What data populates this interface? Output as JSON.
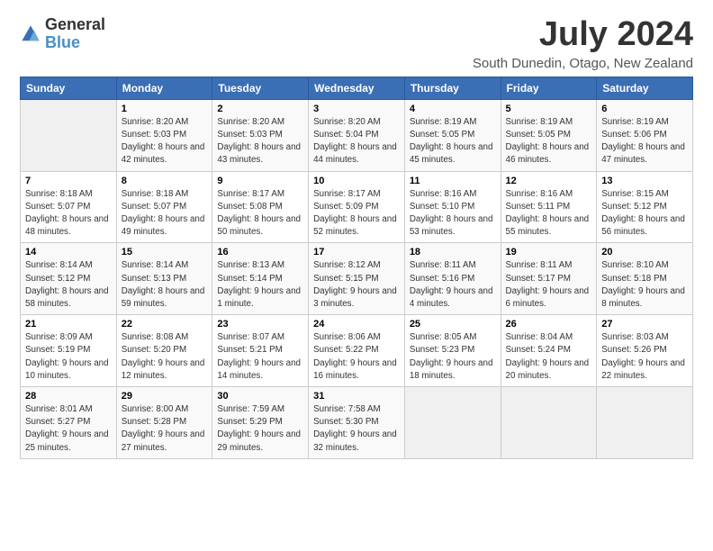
{
  "header": {
    "logo_general": "General",
    "logo_blue": "Blue",
    "title": "July 2024",
    "subtitle": "South Dunedin, Otago, New Zealand"
  },
  "days_of_week": [
    "Sunday",
    "Monday",
    "Tuesday",
    "Wednesday",
    "Thursday",
    "Friday",
    "Saturday"
  ],
  "weeks": [
    [
      {
        "day": "",
        "sunrise": "",
        "sunset": "",
        "daylight": ""
      },
      {
        "day": "1",
        "sunrise": "Sunrise: 8:20 AM",
        "sunset": "Sunset: 5:03 PM",
        "daylight": "Daylight: 8 hours and 42 minutes."
      },
      {
        "day": "2",
        "sunrise": "Sunrise: 8:20 AM",
        "sunset": "Sunset: 5:03 PM",
        "daylight": "Daylight: 8 hours and 43 minutes."
      },
      {
        "day": "3",
        "sunrise": "Sunrise: 8:20 AM",
        "sunset": "Sunset: 5:04 PM",
        "daylight": "Daylight: 8 hours and 44 minutes."
      },
      {
        "day": "4",
        "sunrise": "Sunrise: 8:19 AM",
        "sunset": "Sunset: 5:05 PM",
        "daylight": "Daylight: 8 hours and 45 minutes."
      },
      {
        "day": "5",
        "sunrise": "Sunrise: 8:19 AM",
        "sunset": "Sunset: 5:05 PM",
        "daylight": "Daylight: 8 hours and 46 minutes."
      },
      {
        "day": "6",
        "sunrise": "Sunrise: 8:19 AM",
        "sunset": "Sunset: 5:06 PM",
        "daylight": "Daylight: 8 hours and 47 minutes."
      }
    ],
    [
      {
        "day": "7",
        "sunrise": "Sunrise: 8:18 AM",
        "sunset": "Sunset: 5:07 PM",
        "daylight": "Daylight: 8 hours and 48 minutes."
      },
      {
        "day": "8",
        "sunrise": "Sunrise: 8:18 AM",
        "sunset": "Sunset: 5:07 PM",
        "daylight": "Daylight: 8 hours and 49 minutes."
      },
      {
        "day": "9",
        "sunrise": "Sunrise: 8:17 AM",
        "sunset": "Sunset: 5:08 PM",
        "daylight": "Daylight: 8 hours and 50 minutes."
      },
      {
        "day": "10",
        "sunrise": "Sunrise: 8:17 AM",
        "sunset": "Sunset: 5:09 PM",
        "daylight": "Daylight: 8 hours and 52 minutes."
      },
      {
        "day": "11",
        "sunrise": "Sunrise: 8:16 AM",
        "sunset": "Sunset: 5:10 PM",
        "daylight": "Daylight: 8 hours and 53 minutes."
      },
      {
        "day": "12",
        "sunrise": "Sunrise: 8:16 AM",
        "sunset": "Sunset: 5:11 PM",
        "daylight": "Daylight: 8 hours and 55 minutes."
      },
      {
        "day": "13",
        "sunrise": "Sunrise: 8:15 AM",
        "sunset": "Sunset: 5:12 PM",
        "daylight": "Daylight: 8 hours and 56 minutes."
      }
    ],
    [
      {
        "day": "14",
        "sunrise": "Sunrise: 8:14 AM",
        "sunset": "Sunset: 5:12 PM",
        "daylight": "Daylight: 8 hours and 58 minutes."
      },
      {
        "day": "15",
        "sunrise": "Sunrise: 8:14 AM",
        "sunset": "Sunset: 5:13 PM",
        "daylight": "Daylight: 8 hours and 59 minutes."
      },
      {
        "day": "16",
        "sunrise": "Sunrise: 8:13 AM",
        "sunset": "Sunset: 5:14 PM",
        "daylight": "Daylight: 9 hours and 1 minute."
      },
      {
        "day": "17",
        "sunrise": "Sunrise: 8:12 AM",
        "sunset": "Sunset: 5:15 PM",
        "daylight": "Daylight: 9 hours and 3 minutes."
      },
      {
        "day": "18",
        "sunrise": "Sunrise: 8:11 AM",
        "sunset": "Sunset: 5:16 PM",
        "daylight": "Daylight: 9 hours and 4 minutes."
      },
      {
        "day": "19",
        "sunrise": "Sunrise: 8:11 AM",
        "sunset": "Sunset: 5:17 PM",
        "daylight": "Daylight: 9 hours and 6 minutes."
      },
      {
        "day": "20",
        "sunrise": "Sunrise: 8:10 AM",
        "sunset": "Sunset: 5:18 PM",
        "daylight": "Daylight: 9 hours and 8 minutes."
      }
    ],
    [
      {
        "day": "21",
        "sunrise": "Sunrise: 8:09 AM",
        "sunset": "Sunset: 5:19 PM",
        "daylight": "Daylight: 9 hours and 10 minutes."
      },
      {
        "day": "22",
        "sunrise": "Sunrise: 8:08 AM",
        "sunset": "Sunset: 5:20 PM",
        "daylight": "Daylight: 9 hours and 12 minutes."
      },
      {
        "day": "23",
        "sunrise": "Sunrise: 8:07 AM",
        "sunset": "Sunset: 5:21 PM",
        "daylight": "Daylight: 9 hours and 14 minutes."
      },
      {
        "day": "24",
        "sunrise": "Sunrise: 8:06 AM",
        "sunset": "Sunset: 5:22 PM",
        "daylight": "Daylight: 9 hours and 16 minutes."
      },
      {
        "day": "25",
        "sunrise": "Sunrise: 8:05 AM",
        "sunset": "Sunset: 5:23 PM",
        "daylight": "Daylight: 9 hours and 18 minutes."
      },
      {
        "day": "26",
        "sunrise": "Sunrise: 8:04 AM",
        "sunset": "Sunset: 5:24 PM",
        "daylight": "Daylight: 9 hours and 20 minutes."
      },
      {
        "day": "27",
        "sunrise": "Sunrise: 8:03 AM",
        "sunset": "Sunset: 5:26 PM",
        "daylight": "Daylight: 9 hours and 22 minutes."
      }
    ],
    [
      {
        "day": "28",
        "sunrise": "Sunrise: 8:01 AM",
        "sunset": "Sunset: 5:27 PM",
        "daylight": "Daylight: 9 hours and 25 minutes."
      },
      {
        "day": "29",
        "sunrise": "Sunrise: 8:00 AM",
        "sunset": "Sunset: 5:28 PM",
        "daylight": "Daylight: 9 hours and 27 minutes."
      },
      {
        "day": "30",
        "sunrise": "Sunrise: 7:59 AM",
        "sunset": "Sunset: 5:29 PM",
        "daylight": "Daylight: 9 hours and 29 minutes."
      },
      {
        "day": "31",
        "sunrise": "Sunrise: 7:58 AM",
        "sunset": "Sunset: 5:30 PM",
        "daylight": "Daylight: 9 hours and 32 minutes."
      },
      {
        "day": "",
        "sunrise": "",
        "sunset": "",
        "daylight": ""
      },
      {
        "day": "",
        "sunrise": "",
        "sunset": "",
        "daylight": ""
      },
      {
        "day": "",
        "sunrise": "",
        "sunset": "",
        "daylight": ""
      }
    ]
  ]
}
